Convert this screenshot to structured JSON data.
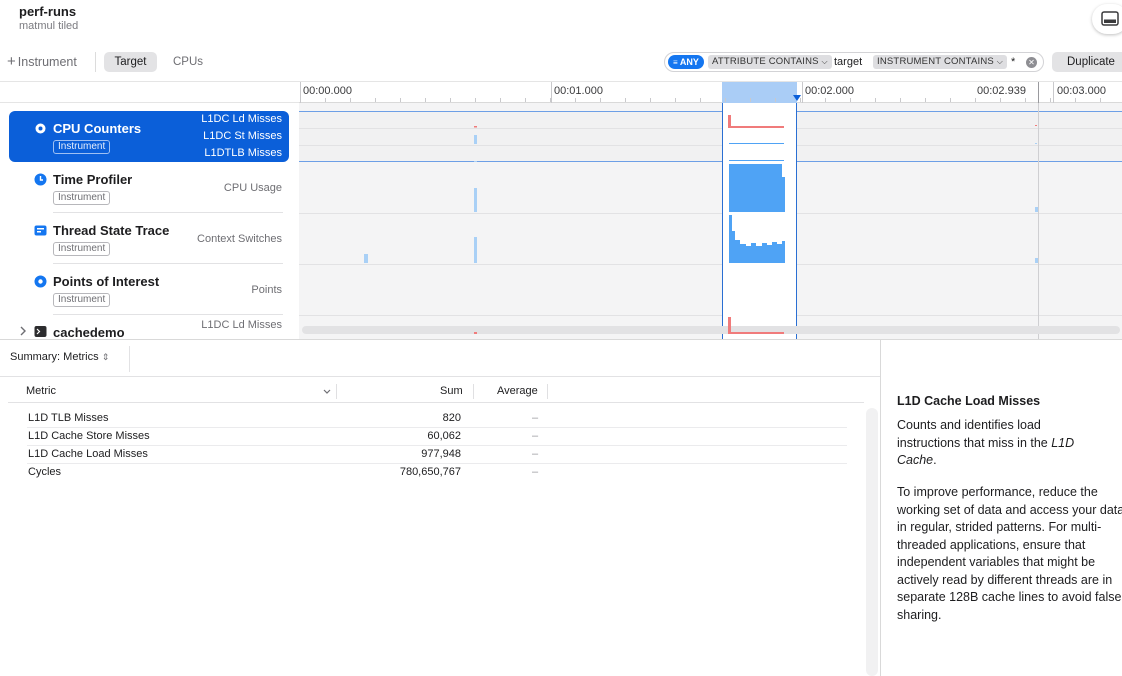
{
  "window": {
    "title": "perf-runs",
    "subtitle": "matmul tiled"
  },
  "toolbar": {
    "add_instrument": "Instrument",
    "tabs": [
      {
        "label": "Target",
        "selected": true
      },
      {
        "label": "CPUs",
        "selected": false
      }
    ],
    "filter": {
      "any_label": "ANY",
      "token1": "ATTRIBUTE CONTAINS",
      "value1": "target",
      "token2": "INSTRUMENT CONTAINS",
      "value2": "*"
    },
    "duplicate_label": "Duplicate"
  },
  "ruler": {
    "labels": [
      "00:00.000",
      "00:01.000",
      "00:02.000",
      "00:02.939",
      "00:03.000"
    ]
  },
  "instruments": [
    {
      "name": "CPU Counters",
      "badge": "Instrument",
      "metrics": [
        "L1DC Ld Misses",
        "L1DC St Misses",
        "L1DTLB Misses"
      ],
      "selected": true,
      "icon": "gear-icon"
    },
    {
      "name": "Time Profiler",
      "badge": "Instrument",
      "metrics": [
        "CPU Usage"
      ],
      "selected": false,
      "icon": "clock-icon"
    },
    {
      "name": "Thread State Trace",
      "badge": "Instrument",
      "metrics": [
        "Context Switches"
      ],
      "selected": false,
      "icon": "thread-icon"
    },
    {
      "name": "Points of Interest",
      "badge": "Instrument",
      "metrics": [
        "Points"
      ],
      "selected": false,
      "icon": "pin-icon"
    },
    {
      "name": "cachedemo",
      "metrics": [
        "L1DC Ld Misses"
      ],
      "selected": false,
      "icon": "terminal-icon"
    }
  ],
  "summary": {
    "label": "Summary: Metrics"
  },
  "table": {
    "columns": [
      "Metric",
      "Sum",
      "Average"
    ],
    "rows": [
      {
        "metric": "L1D TLB Misses",
        "sum": "820",
        "average": "–"
      },
      {
        "metric": "L1D Cache Store Misses",
        "sum": "60,062",
        "average": "–"
      },
      {
        "metric": "L1D Cache Load Misses",
        "sum": "977,948",
        "average": "–"
      },
      {
        "metric": "Cycles",
        "sum": "780,650,767",
        "average": "–"
      }
    ]
  },
  "inspector": {
    "title": "L1D Cache Load Misses",
    "para1_prefix": "Counts and identifies load instructions that miss in the ",
    "para1_em": "L1D Cache",
    "para1_suffix": ".",
    "para2": "To improve performance, reduce the working set of data and access your data in regular, strided patterns. For multi-threaded applications, ensure that independent variables that might be actively read by different threads are in separate 128B cache lines to avoid false sharing."
  },
  "colors": {
    "accent": "#0b5fd9",
    "selection": "#aacdf6",
    "bar_blue": "#4fa3f5",
    "bar_light_blue": "#a9d0f6",
    "bar_red": "#f07b7b"
  }
}
